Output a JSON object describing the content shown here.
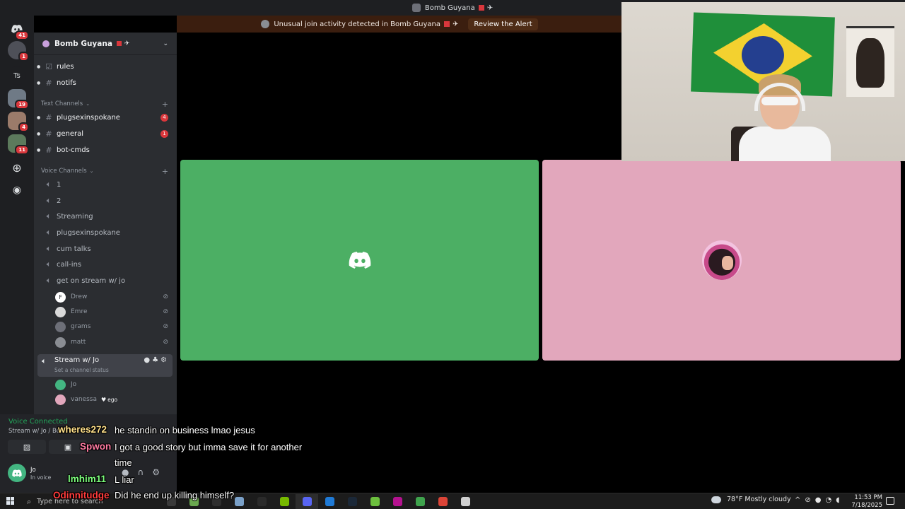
{
  "window": {
    "title": "Bomb Guyana"
  },
  "alert": {
    "text": "Unusual join activity detected in Bomb Guyana",
    "button": "Review the Alert"
  },
  "rail": {
    "badges": [
      "41",
      "1",
      "19",
      "4",
      "11"
    ],
    "ts_label": "Ts"
  },
  "guild": {
    "name": "Bomb Guyana"
  },
  "channels": {
    "top": [
      {
        "name": "rules"
      },
      {
        "name": "notifs"
      }
    ],
    "text_category": "Text Channels",
    "text": [
      {
        "name": "plugsexinspokane",
        "badge": "4"
      },
      {
        "name": "general",
        "badge": "1"
      },
      {
        "name": "bot-cmds"
      }
    ],
    "voice_category": "Voice Channels",
    "voice": [
      {
        "name": "1"
      },
      {
        "name": "2"
      },
      {
        "name": "Streaming"
      },
      {
        "name": "plugsexinspokane"
      },
      {
        "name": "cum talks"
      },
      {
        "name": "call-ins"
      },
      {
        "name": "get on stream w/ jo"
      }
    ],
    "voice_users": [
      {
        "name": "Drew",
        "initial": "F",
        "color": "#ffffff"
      },
      {
        "name": "Emre",
        "initial": "",
        "color": "#d9d9d9"
      },
      {
        "name": "grams",
        "initial": "",
        "color": "#6d6f78"
      },
      {
        "name": "matt",
        "initial": "",
        "color": "#8a8d93"
      }
    ],
    "stream_channel": {
      "name": "Stream w/ Jo",
      "status": "Set a channel status"
    },
    "stream_users": [
      {
        "name": "Jo",
        "color": "#43b581"
      },
      {
        "name": "vanessa",
        "color": "#e2a7bc",
        "tag": "ego"
      }
    ]
  },
  "voice_panel": {
    "status": "Voice Connected",
    "channel": "Stream w/ Jo / Bo"
  },
  "user_panel": {
    "name": "Jo",
    "status": "In voice"
  },
  "chat": [
    {
      "user": "wheres272",
      "color": "#ffe08a",
      "text": "he standin on business lmao jesus"
    },
    {
      "user": "Spwon",
      "color": "#ff7aa2",
      "text": "I got a good story but imma save it for another"
    },
    {
      "user": "",
      "color": "#ffffff",
      "text": "time"
    },
    {
      "user": "lmhim11",
      "color": "#7dff7d",
      "text": "L liar"
    },
    {
      "user": "Odinnitudge",
      "color": "#ff3b3b",
      "text": "Did he end up killing himself?"
    }
  ],
  "taskbar": {
    "search_placeholder": "Type here to search",
    "weather": "78°F  Mostly cloudy",
    "time": "11:53 PM",
    "date": "7/18/2025",
    "app_colors": [
      "#3a3a3a",
      "#6aa84f",
      "#2f2f2f",
      "#7aa0c8",
      "#2a2a2a",
      "#76b900",
      "#5865f2",
      "#1f7ad6",
      "#1b2838",
      "#6cbf3e",
      "#b4128f",
      "#3fa34d",
      "#db4437",
      "#d0d0d0"
    ]
  }
}
